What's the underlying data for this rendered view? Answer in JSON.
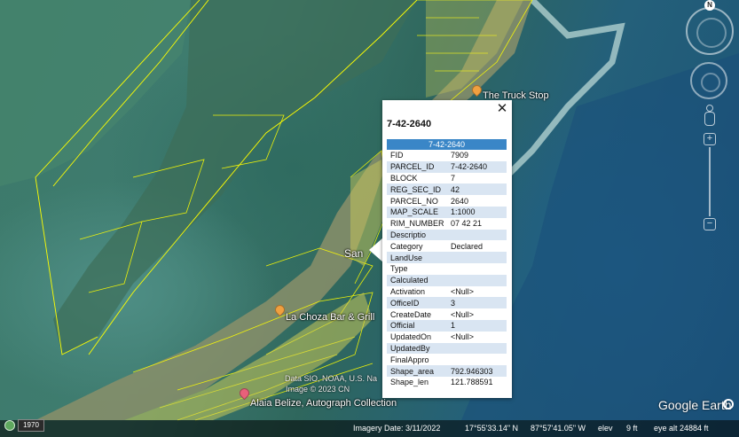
{
  "map": {
    "places": [
      {
        "name": "The Truck Stop",
        "pin_color": "#f0a040"
      },
      {
        "name": "La Choza Bar & Grill",
        "pin_color": "#f0a040"
      },
      {
        "name": "Alaia Belize, Autograph Collection",
        "pin_color": "#e8607a"
      },
      {
        "name": "San",
        "pin_color": ""
      }
    ],
    "attribution": {
      "line1": "Data SIO, NOAA, U.S. Na",
      "line2": "Image © 2023 CN"
    },
    "parcel_color": "#ffff00"
  },
  "navigation": {
    "north_label": "N"
  },
  "popup": {
    "title": "7-42-2640",
    "close_glyph": "✕",
    "table_header": "7-42-2640",
    "rows": [
      {
        "key": "FID",
        "value": "7909"
      },
      {
        "key": "PARCEL_ID",
        "value": "7-42-2640"
      },
      {
        "key": "BLOCK",
        "value": "7"
      },
      {
        "key": "REG_SEC_ID",
        "value": "42"
      },
      {
        "key": "PARCEL_NO",
        "value": "2640"
      },
      {
        "key": "MAP_SCALE",
        "value": "1:1000"
      },
      {
        "key": "RIM_NUMBER",
        "value": "07 42 21"
      },
      {
        "key": "Descriptio",
        "value": ""
      },
      {
        "key": "Category",
        "value": "Declared"
      },
      {
        "key": "LandUse",
        "value": ""
      },
      {
        "key": "Type",
        "value": ""
      },
      {
        "key": "Calculated",
        "value": ""
      },
      {
        "key": "Activation",
        "value": "<Null>"
      },
      {
        "key": "OfficeID",
        "value": "3"
      },
      {
        "key": "CreateDate",
        "value": "<Null>"
      },
      {
        "key": "Official",
        "value": "1"
      },
      {
        "key": "UpdatedOn",
        "value": "<Null>"
      },
      {
        "key": "UpdatedBy",
        "value": ""
      },
      {
        "key": "FinalAppro",
        "value": ""
      },
      {
        "key": "Shape_area",
        "value": "792.946303"
      },
      {
        "key": "Shape_len",
        "value": "121.788591"
      }
    ]
  },
  "statusbar": {
    "history_label": "1970",
    "imagery_date": "Imagery Date: 3/11/2022",
    "latitude": "17°55'33.14\" N",
    "longitude": "87°57'41.05\" W",
    "elev_label": "elev",
    "elev_value": "9 ft",
    "eye_alt": "eye alt  24884 ft"
  },
  "brand": {
    "name": "Google Earth"
  }
}
